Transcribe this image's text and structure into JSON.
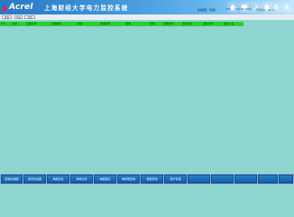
{
  "header": {
    "logo": "Acrel",
    "title": "上海财经大学电力监控系统",
    "status": [
      "最新报警：测试告",
      "2022-04-21 08:00:00",
      "当前用户：admin"
    ],
    "icons": [
      "home-icon",
      "monitor-icon",
      "wrench-icon",
      "alarm-icon",
      "power-tower-icon",
      "power-tower-icon"
    ]
  },
  "toolbar": {
    "buttons": [
      "查询",
      "导出",
      "打印"
    ]
  },
  "table": {
    "columns": [
      "序号",
      "名称",
      "回路名称",
      "回路编号",
      "状态",
      "报警类型",
      "数值",
      "限值",
      "报警时间",
      "恢复时间",
      "确认时间",
      "确认人员"
    ]
  },
  "bottom_tabs": [
    "配电系统图",
    "通讯状态图",
    "电能抄表",
    "用电分析",
    "电能报表",
    "电参量查询",
    "报警查询",
    "用户管理",
    "",
    "",
    "",
    "",
    ""
  ]
}
